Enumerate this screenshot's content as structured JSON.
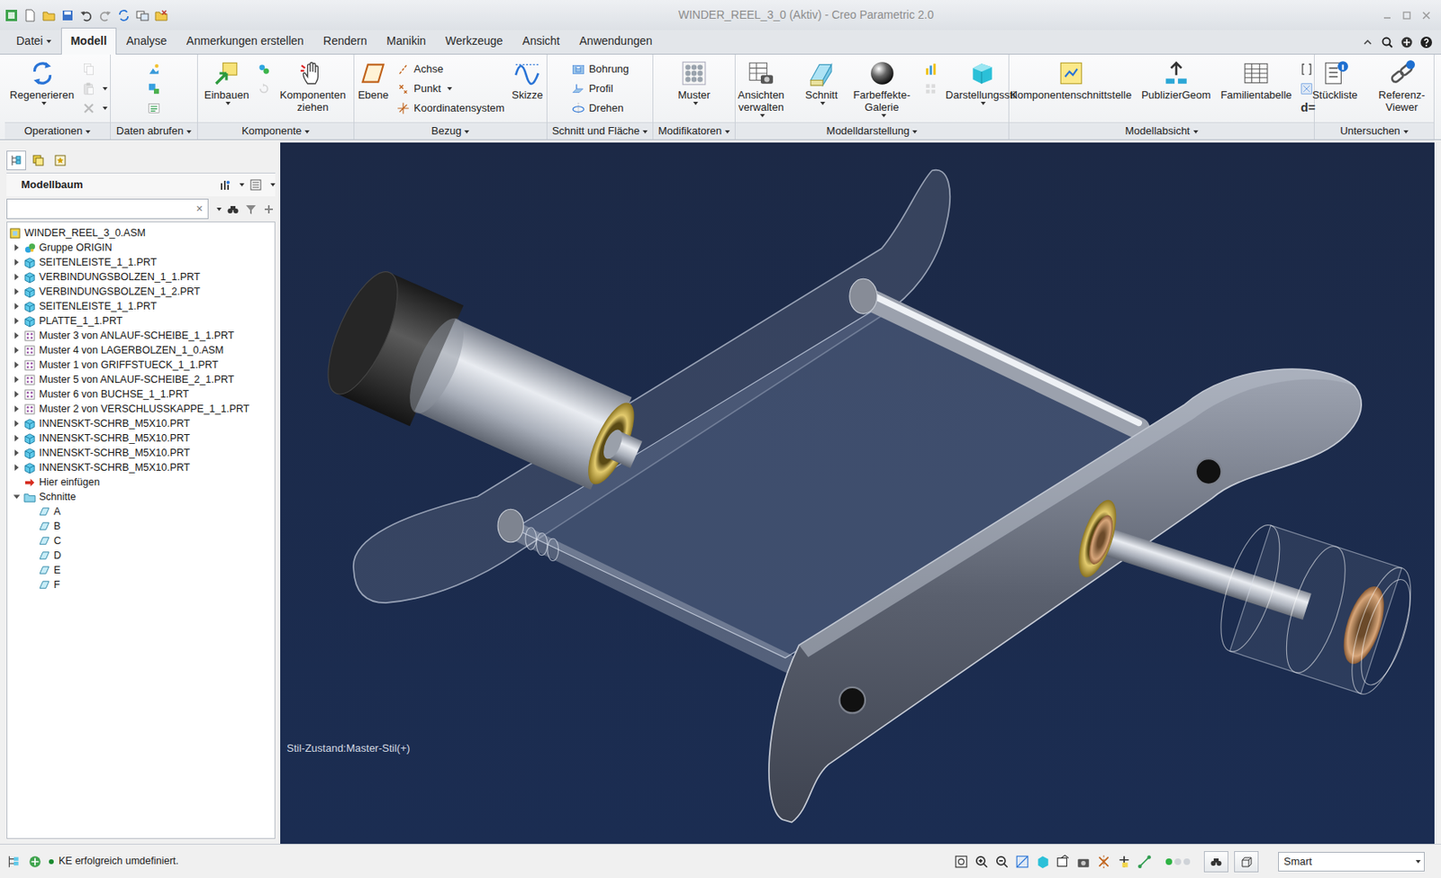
{
  "window": {
    "title": "WINDER_REEL_3_0 (Aktiv) - Creo Parametric 2.0"
  },
  "tabs": [
    {
      "label": "Datei",
      "selected": false,
      "dropdown": true
    },
    {
      "label": "Modell",
      "selected": true
    },
    {
      "label": "Analyse",
      "selected": false
    },
    {
      "label": "Anmerkungen erstellen",
      "selected": false
    },
    {
      "label": "Rendern",
      "selected": false
    },
    {
      "label": "Manikin",
      "selected": false
    },
    {
      "label": "Werkzeuge",
      "selected": false
    },
    {
      "label": "Ansicht",
      "selected": false
    },
    {
      "label": "Anwendungen",
      "selected": false
    }
  ],
  "ribbon": {
    "groups": [
      {
        "label": "Operationen",
        "dropdown": true,
        "items": [
          {
            "kind": "large",
            "label": "Regenerieren",
            "dropdown": true
          },
          {
            "kind": "stack",
            "items": [
              {
                "kind": "icon",
                "disabled": true,
                "dropdown": false
              },
              {
                "kind": "icon",
                "disabled": true,
                "dropdown": true
              },
              {
                "kind": "icon",
                "disabled": true,
                "dropdown": true
              }
            ]
          }
        ]
      },
      {
        "label": "Daten abrufen",
        "dropdown": true,
        "items": [
          {
            "kind": "stack",
            "items": [
              {
                "kind": "icon",
                "disabled": false,
                "dropdown": false
              },
              {
                "kind": "icon",
                "disabled": false,
                "dropdown": false
              },
              {
                "kind": "icon",
                "disabled": false,
                "dropdown": false
              }
            ]
          }
        ]
      },
      {
        "label": "Komponente",
        "dropdown": true,
        "items": [
          {
            "kind": "large",
            "label": "Einbauen",
            "dropdown": true
          },
          {
            "kind": "stack",
            "items": [
              {
                "kind": "icon",
                "disabled": false,
                "dropdown": false
              },
              {
                "kind": "icon",
                "disabled": true,
                "dropdown": false
              }
            ]
          },
          {
            "kind": "large",
            "label": "Komponenten ziehen",
            "dropdown": false
          }
        ]
      },
      {
        "label": "Bezug",
        "dropdown": true,
        "items": [
          {
            "kind": "large",
            "label": "Ebene",
            "dropdown": false
          },
          {
            "kind": "stack",
            "items": [
              {
                "kind": "labeled",
                "label": "Achse",
                "disabled": false,
                "dropdown": false
              },
              {
                "kind": "labeled",
                "label": "Punkt",
                "disabled": false,
                "dropdown": true
              },
              {
                "kind": "labeled",
                "label": "Koordinatensystem",
                "disabled": false,
                "dropdown": false
              }
            ]
          },
          {
            "kind": "large",
            "label": "Skizze",
            "dropdown": false
          }
        ]
      },
      {
        "label": "Schnitt und Fläche",
        "dropdown": true,
        "items": [
          {
            "kind": "stack",
            "items": [
              {
                "kind": "labeled",
                "label": "Bohrung",
                "disabled": false,
                "dropdown": false
              },
              {
                "kind": "labeled",
                "label": "Profil",
                "disabled": false,
                "dropdown": false
              },
              {
                "kind": "labeled",
                "label": "Drehen",
                "disabled": false,
                "dropdown": false
              }
            ]
          }
        ]
      },
      {
        "label": "Modifikatoren",
        "dropdown": true,
        "items": [
          {
            "kind": "large",
            "label": "Muster",
            "dropdown": true
          }
        ]
      },
      {
        "label": "Modelldarstellung",
        "dropdown": true,
        "items": [
          {
            "kind": "large",
            "label": "Ansichten verwalten",
            "dropdown": true
          },
          {
            "kind": "large",
            "label": "Schnitt",
            "dropdown": true
          },
          {
            "kind": "large",
            "label": "Farbeffekte-Galerie",
            "dropdown": true
          },
          {
            "kind": "stack",
            "items": [
              {
                "kind": "icon",
                "disabled": false,
                "dropdown": false
              },
              {
                "kind": "icon",
                "disabled": true,
                "dropdown": false
              }
            ]
          },
          {
            "kind": "large",
            "label": "Darstellungsstil",
            "dropdown": true
          }
        ]
      },
      {
        "label": "Modellabsicht",
        "dropdown": true,
        "items": [
          {
            "kind": "large",
            "label": "Komponentenschnittstelle",
            "dropdown": false
          },
          {
            "kind": "large",
            "label": "PublizierGeom",
            "dropdown": false
          },
          {
            "kind": "large",
            "label": "Familientabelle",
            "dropdown": false
          },
          {
            "kind": "stack",
            "items": [
              {
                "kind": "icon",
                "disabled": false,
                "dropdown": false
              },
              {
                "kind": "icon",
                "disabled": false,
                "dropdown": false
              },
              {
                "kind": "glyph",
                "label": "d=",
                "disabled": false,
                "dropdown": false
              }
            ]
          }
        ]
      },
      {
        "label": "Untersuchen",
        "dropdown": true,
        "items": [
          {
            "kind": "large",
            "label": "Stückliste",
            "dropdown": false
          },
          {
            "kind": "large",
            "label": "Referenz-Viewer",
            "dropdown": false
          }
        ]
      }
    ]
  },
  "sidebar": {
    "tabs": [
      {
        "selected": true
      },
      {
        "selected": false
      },
      {
        "selected": false
      }
    ],
    "title": "Modellbaum",
    "search": {
      "value": "",
      "clear": "×"
    }
  },
  "tree": {
    "label": "WINDER_REEL_3_0.ASM",
    "kind": "assembly",
    "children": [
      {
        "label": "Gruppe ORIGIN",
        "kind": "group",
        "expanded": false
      },
      {
        "label": "SEITENLEISTE_1_1.PRT",
        "kind": "part",
        "expanded": false
      },
      {
        "label": "VERBINDUNGSBOLZEN_1_1.PRT",
        "kind": "part",
        "expanded": false
      },
      {
        "label": "VERBINDUNGSBOLZEN_1_2.PRT",
        "kind": "part",
        "expanded": false
      },
      {
        "label": "SEITENLEISTE_1_1.PRT",
        "kind": "part",
        "expanded": false
      },
      {
        "label": "PLATTE_1_1.PRT",
        "kind": "part",
        "expanded": false
      },
      {
        "label": "Muster 3 von ANLAUF-SCHEIBE_1_1.PRT",
        "kind": "pattern",
        "expanded": false
      },
      {
        "label": "Muster 4 von LAGERBOLZEN_1_0.ASM",
        "kind": "pattern",
        "expanded": false
      },
      {
        "label": "Muster 1 von GRIFFSTUECK_1_1.PRT",
        "kind": "pattern",
        "expanded": false
      },
      {
        "label": "Muster 5 von ANLAUF-SCHEIBE_2_1.PRT",
        "kind": "pattern",
        "expanded": false
      },
      {
        "label": "Muster 6 von BUCHSE_1_1.PRT",
        "kind": "pattern",
        "expanded": false
      },
      {
        "label": "Muster 2 von VERSCHLUSSKAPPE_1_1.PRT",
        "kind": "pattern",
        "expanded": false
      },
      {
        "label": "INNENSKT-SCHRB_M5X10.PRT",
        "kind": "part",
        "expanded": false
      },
      {
        "label": "INNENSKT-SCHRB_M5X10.PRT",
        "kind": "part",
        "expanded": false
      },
      {
        "label": "INNENSKT-SCHRB_M5X10.PRT",
        "kind": "part",
        "expanded": false
      },
      {
        "label": "INNENSKT-SCHRB_M5X10.PRT",
        "kind": "part",
        "expanded": false
      },
      {
        "label": "Hier einfügen",
        "kind": "insert"
      },
      {
        "label": "Schnitte",
        "kind": "folder",
        "expanded": true,
        "children": [
          {
            "label": "A",
            "kind": "section"
          },
          {
            "label": "B",
            "kind": "section"
          },
          {
            "label": "C",
            "kind": "section"
          },
          {
            "label": "D",
            "kind": "section"
          },
          {
            "label": "E",
            "kind": "section"
          },
          {
            "label": "F",
            "kind": "section"
          }
        ]
      }
    ]
  },
  "viewport": {
    "style_state": "Stil-Zustand:Master-Stil(+)"
  },
  "status_bar": {
    "message": "KE erfolgreich umdefiniert.",
    "filter": "Smart"
  }
}
